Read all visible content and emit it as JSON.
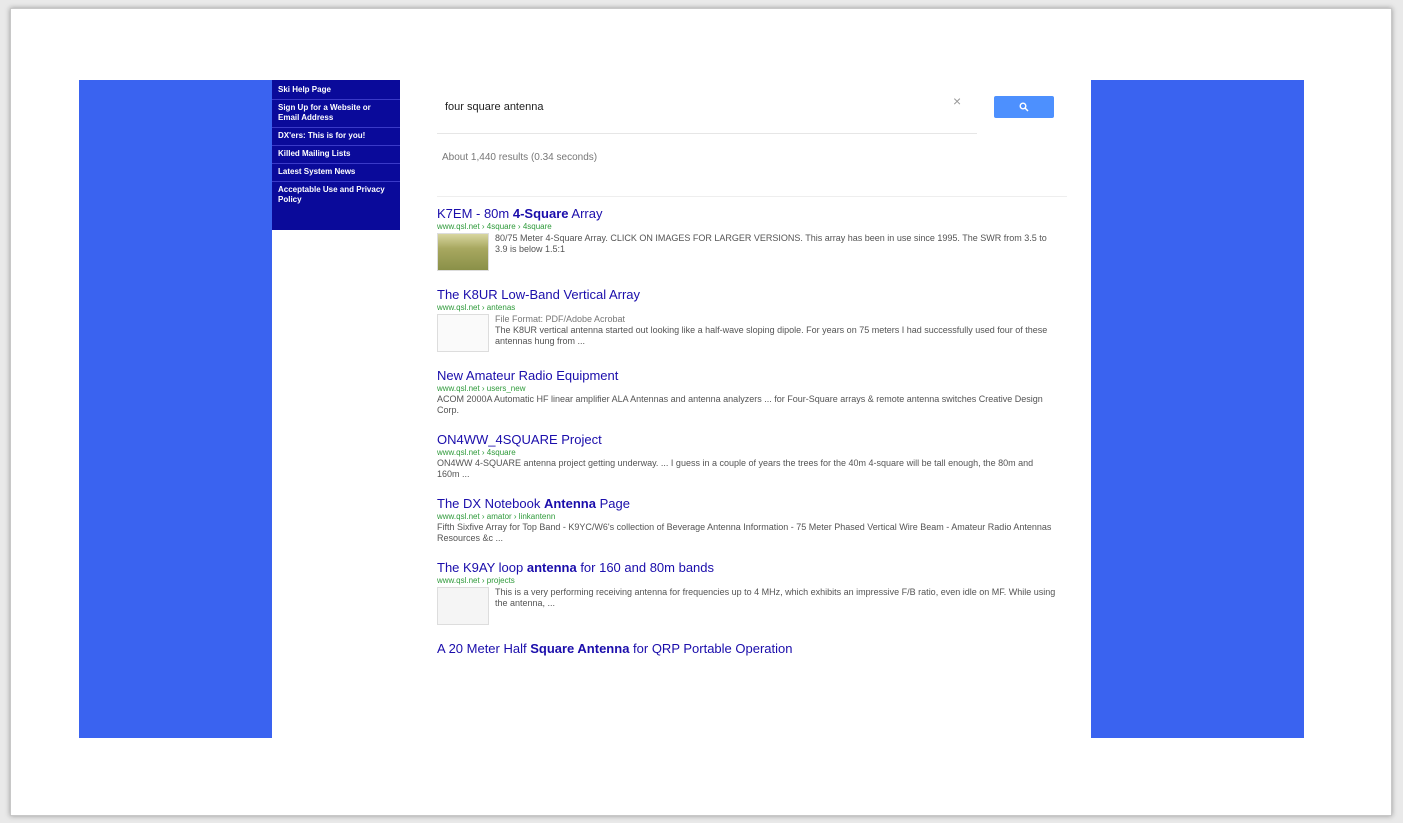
{
  "nav": {
    "items": [
      "Ski Help Page",
      "Sign Up for a Website or Email Address",
      "DX'ers: This is for you!",
      "Killed Mailing Lists",
      "Latest System News",
      "Acceptable Use and Privacy Policy"
    ]
  },
  "search": {
    "query": "four square antenna",
    "clear": "×",
    "stats": "About 1,440 results (0.34 seconds)"
  },
  "results": [
    {
      "title_pre": "K7EM - 80m ",
      "title_bold": "4-Square",
      "title_post": " Array",
      "url": "www.qsl.net › 4square › 4square",
      "snippet": "80/75 Meter 4-Square Array. CLICK ON IMAGES FOR LARGER VERSIONS. This array has been in use since 1995. The SWR from 3.5 to 3.9 is below 1.5:1",
      "meta": ""
    },
    {
      "title_pre": "The K8UR Low-Band Vertical Array",
      "title_bold": "",
      "title_post": "",
      "url": "www.qsl.net › antenas",
      "meta": "File Format: PDF/Adobe Acrobat",
      "snippet": "The K8UR vertical antenna started out looking like a half-wave sloping dipole. For years on 75 meters I had successfully used four of these antennas hung from ..."
    },
    {
      "title_pre": "New Amateur Radio Equipment",
      "title_bold": "",
      "title_post": "",
      "url": "www.qsl.net › users_new",
      "meta": "",
      "snippet": "ACOM 2000A Automatic HF linear amplifier ALA Antennas and antenna analyzers ... for Four-Square arrays & remote antenna switches Creative Design Corp."
    },
    {
      "title_pre": "ON4WW_4SQUARE Project",
      "title_bold": "",
      "title_post": "",
      "url": "www.qsl.net › 4square",
      "meta": "",
      "snippet": "ON4WW 4-SQUARE antenna project getting underway. ... I guess in a couple of years the trees for the 40m 4-square will be tall enough, the 80m and 160m ..."
    },
    {
      "title_pre": "The DX Notebook ",
      "title_bold": "Antenna",
      "title_post": " Page",
      "url": "www.qsl.net › amator › linkantenn",
      "meta": "",
      "snippet": "Fifth Sixfive Array for Top Band - K9YC/W6's collection of Beverage Antenna Information - 75 Meter Phased Vertical Wire Beam - Amateur Radio Antennas Resources &c ..."
    },
    {
      "title_pre": "The K9AY loop ",
      "title_bold": "antenna",
      "title_post": " for 160 and 80m bands",
      "url": "www.qsl.net › projects",
      "meta": "",
      "snippet": "This is a very performing receiving antenna for frequencies up to 4 MHz, which exhibits an impressive F/B ratio, even idle on MF. While using the antenna, ..."
    },
    {
      "title_pre": "A 20 Meter Half ",
      "title_bold": "Square Antenna",
      "title_post": " for QRP Portable Operation",
      "url": "",
      "meta": "",
      "snippet": ""
    }
  ],
  "icons": {
    "search": "search-icon",
    "clear": "close-icon"
  },
  "colors": {
    "side_panel": "#3a63f0",
    "nav_bg": "#0a0a9a",
    "button": "#4d90fe",
    "link": "#1a0dab",
    "url": "#2e9a3a"
  }
}
